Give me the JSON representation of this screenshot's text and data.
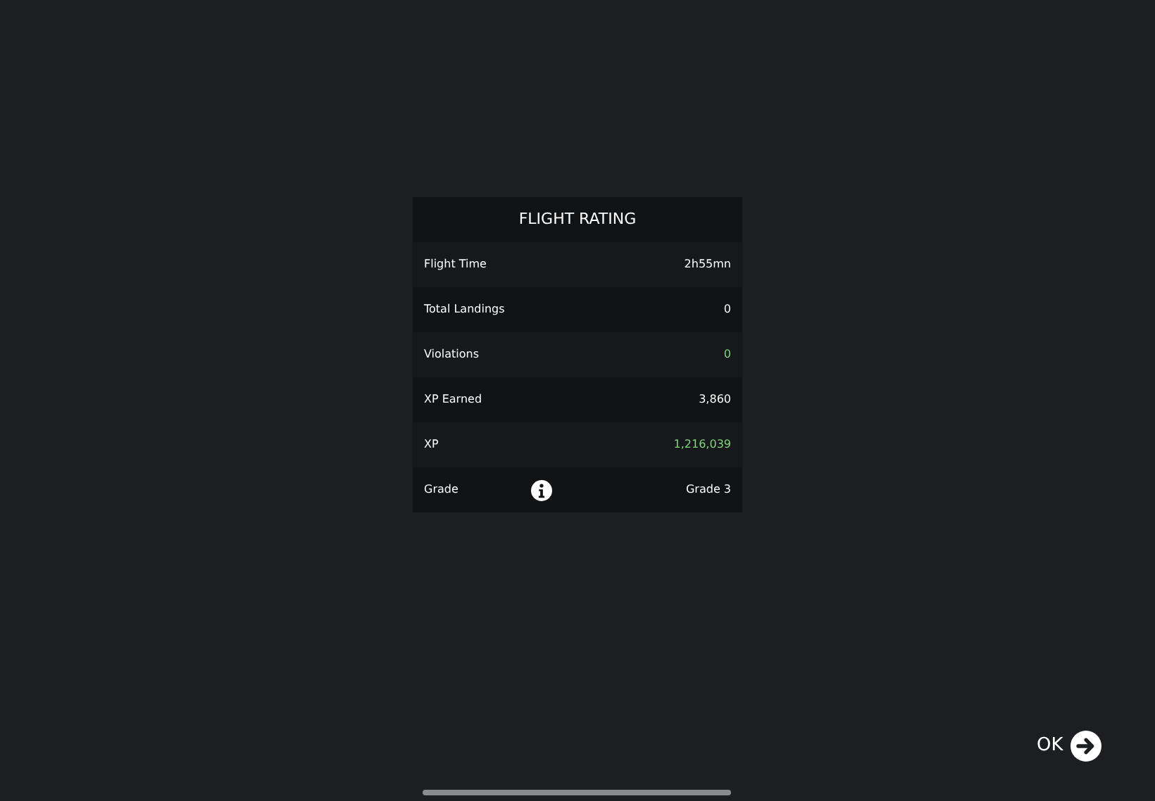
{
  "panel": {
    "title": "FLIGHT RATING",
    "rows": [
      {
        "label": "Flight Time",
        "value": "2h55mn",
        "color": "#ffffff",
        "info": false
      },
      {
        "label": "Total Landings",
        "value": "0",
        "color": "#ffffff",
        "info": false
      },
      {
        "label": "Violations",
        "value": "0",
        "color": "#7fd67a",
        "info": false
      },
      {
        "label": "XP Earned",
        "value": "3,860",
        "color": "#ffffff",
        "info": false
      },
      {
        "label": "XP",
        "value": "1,216,039",
        "color": "#7fd67a",
        "info": false
      },
      {
        "label": "Grade",
        "value": "Grade 3",
        "color": "#ffffff",
        "info": true
      }
    ]
  },
  "ok_button": {
    "label": "OK"
  }
}
